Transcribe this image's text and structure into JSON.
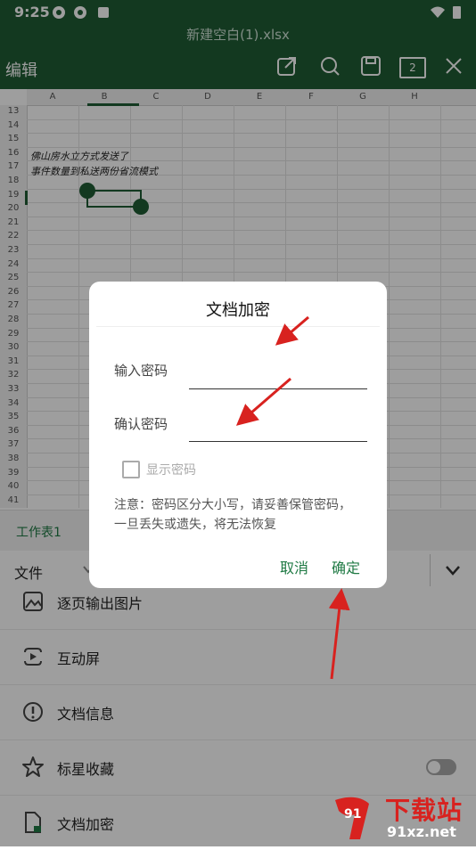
{
  "status": {
    "time": "9:25"
  },
  "window": {
    "title": "新建空白(1).xlsx"
  },
  "toolbar": {
    "mode_label": "编辑",
    "tab_count": "2"
  },
  "sheet": {
    "columns": [
      "A",
      "B",
      "C",
      "D",
      "E",
      "F",
      "G",
      "H"
    ],
    "rows": [
      "13",
      "14",
      "15",
      "16",
      "17",
      "18",
      "19",
      "20",
      "21",
      "22",
      "23",
      "24",
      "25",
      "26",
      "27",
      "28",
      "29",
      "30",
      "31",
      "32",
      "33",
      "34",
      "35",
      "36",
      "37",
      "38",
      "39",
      "40",
      "41"
    ],
    "cell_text": [
      "佛山房水立方式发送了",
      "事件数量到私送两份省流模式"
    ]
  },
  "dialog": {
    "title": "文档加密",
    "password_label": "输入密码",
    "confirm_label": "确认密码",
    "show_password": "显示密码",
    "note": "注意：密码区分大小写，请妥善保管密码，一旦丢失或遗失，将无法恢复",
    "cancel": "取消",
    "ok": "确定"
  },
  "sheet_tabs": {
    "active": "工作表1"
  },
  "file_menu": {
    "label": "文件"
  },
  "menu_items": [
    {
      "label": "逐页输出图片"
    },
    {
      "label": "互动屏"
    },
    {
      "label": "文档信息"
    },
    {
      "label": "标星收藏"
    },
    {
      "label": "文档加密"
    }
  ],
  "watermark": {
    "text": "下载站",
    "url": "91xz.net"
  }
}
